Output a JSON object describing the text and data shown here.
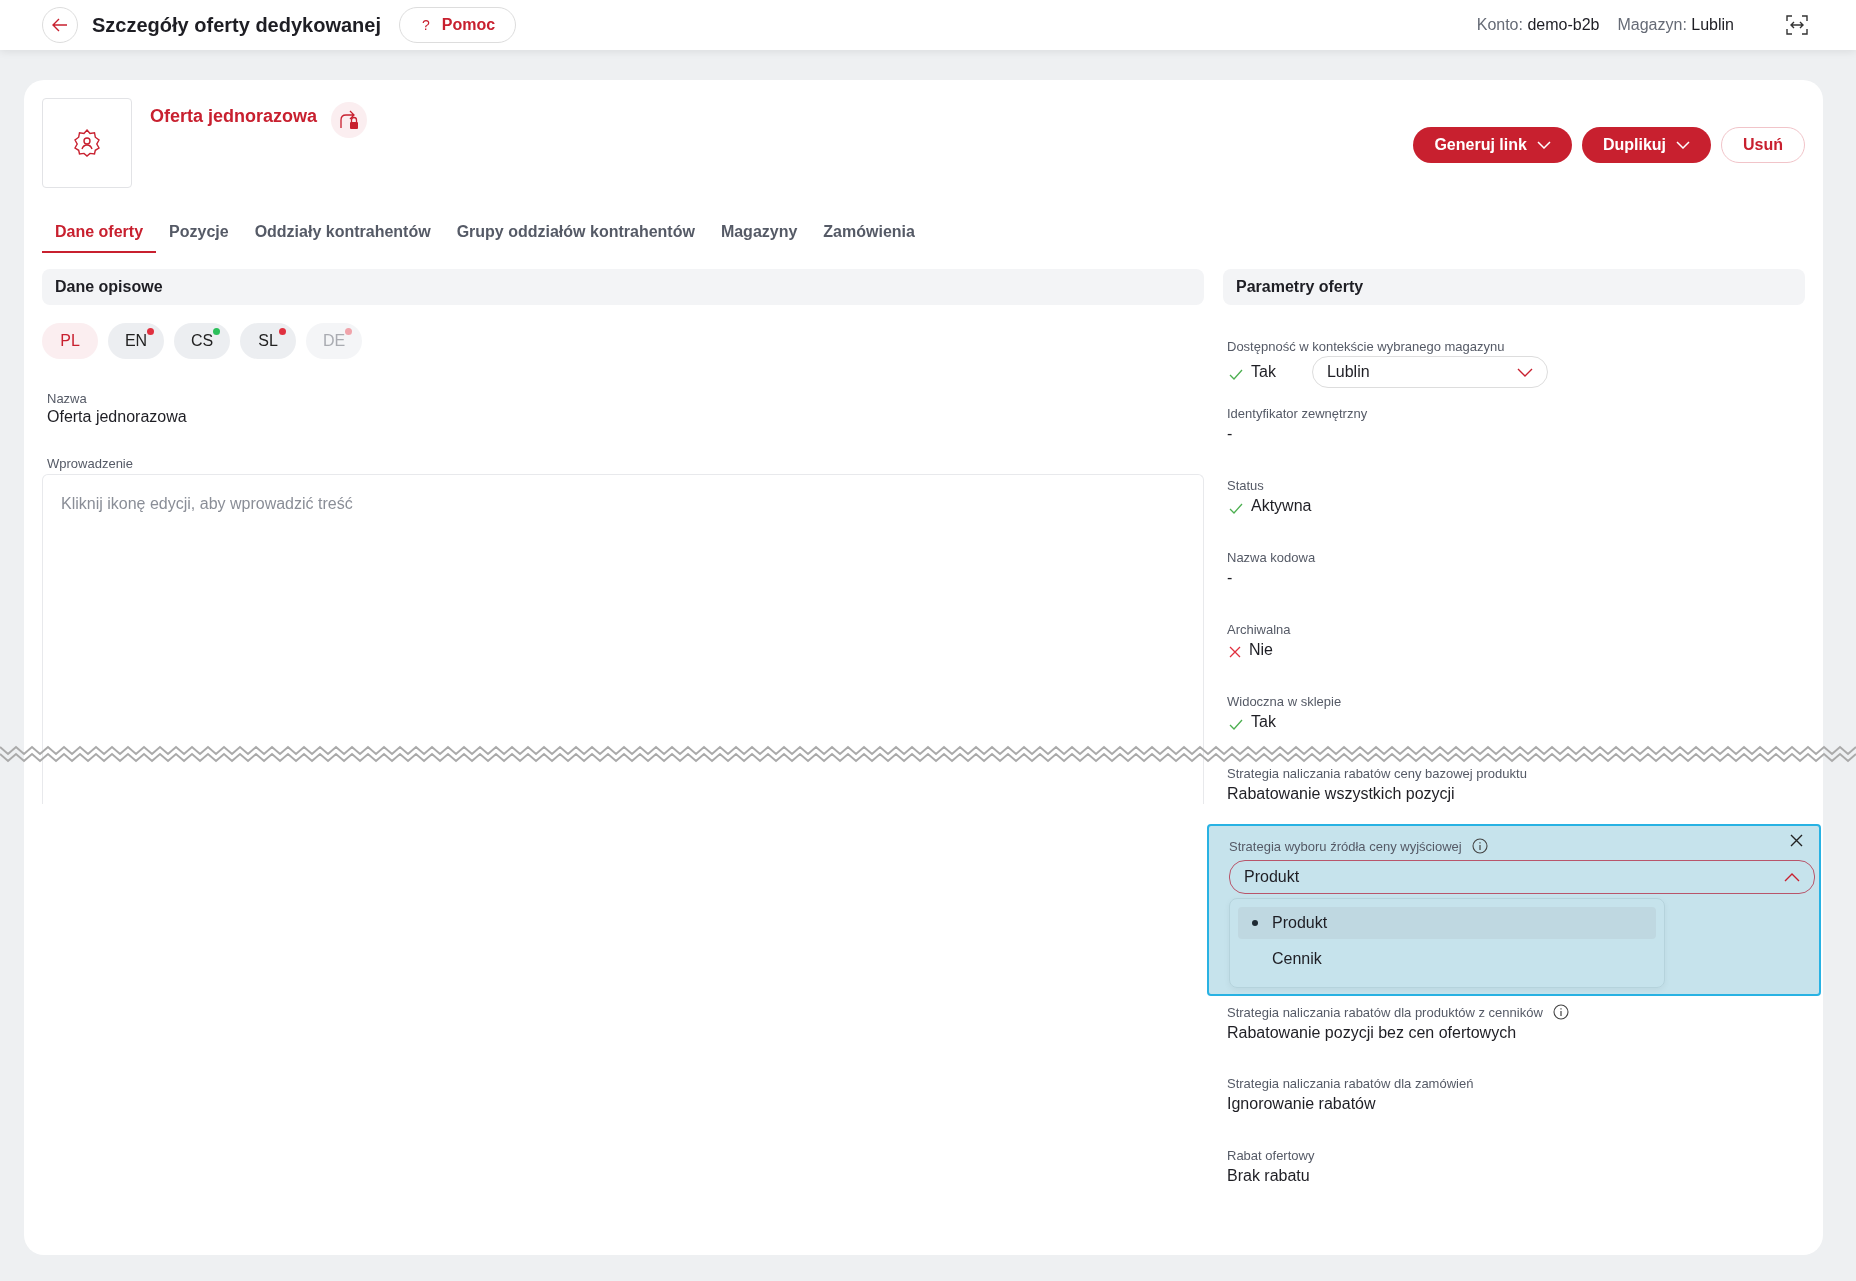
{
  "header": {
    "title": "Szczegóły oferty dedykowanej",
    "help_button": {
      "icon": "?",
      "label": "Pomoc"
    },
    "account": {
      "label": "Konto:",
      "value": "demo-b2b"
    },
    "warehouse": {
      "label": "Magazyn:",
      "value": "Lublin"
    }
  },
  "offer": {
    "name": "Oferta jednorazowa",
    "actions": [
      {
        "label": "Generuj link",
        "kind": "dropdown"
      },
      {
        "label": "Duplikuj",
        "kind": "dropdown"
      },
      {
        "label": "Usuń",
        "kind": "outline"
      }
    ]
  },
  "tabs": [
    {
      "label": "Dane oferty",
      "selected": true
    },
    {
      "label": "Pozycje",
      "selected": false
    },
    {
      "label": "Oddziały kontrahentów",
      "selected": false
    },
    {
      "label": "Grupy oddziałów kontrahentów",
      "selected": false
    },
    {
      "label": "Magazyny",
      "selected": false
    },
    {
      "label": "Zamówienia",
      "selected": false
    }
  ],
  "descriptive": {
    "title": "Dane opisowe",
    "languages": [
      {
        "code": "PL",
        "selected": true,
        "disabled": false
      },
      {
        "code": "EN",
        "selected": false,
        "disabled": false,
        "color": "#e0303f"
      },
      {
        "code": "CS",
        "selected": false,
        "disabled": false,
        "color": "#2bbf5a"
      },
      {
        "code": "SL",
        "selected": false,
        "disabled": false,
        "color": "#e0303f"
      },
      {
        "code": "DE",
        "selected": false,
        "disabled": true,
        "color": "#f0a3aa"
      }
    ],
    "name": {
      "label": "Nazwa",
      "value": "Oferta jednorazowa"
    },
    "intro": {
      "label": "Wprowadzenie",
      "placeholder": "Kliknij ikonę edycji, aby wprowadzić treść"
    }
  },
  "parameters": {
    "title": "Parametry oferty",
    "items": [
      {
        "kind": "availability",
        "label": "Dostępność w kontekście wybranego magazynu",
        "ok": true,
        "value": "Tak",
        "select": "Lublin"
      },
      {
        "kind": "text",
        "label": "Identyfikator zewnętrzny",
        "value": "-"
      },
      {
        "kind": "flag",
        "label": "Status",
        "ok": true,
        "value": "Aktywna"
      },
      {
        "kind": "text",
        "label": "Nazwa kodowa",
        "value": "-"
      },
      {
        "kind": "flag",
        "label": "Archiwalna",
        "ok": false,
        "value": "Nie"
      },
      {
        "kind": "flag",
        "label": "Widoczna w sklepie",
        "ok": true,
        "value": "Tak"
      },
      {
        "kind": "text",
        "label": "Strategia naliczania rabatów ceny bazowej produktu",
        "value": "Rabatowanie wszystkich pozycji"
      },
      {
        "kind": "open_select",
        "label": "Strategia wyboru źródła ceny wyjściowej",
        "info": true,
        "highlighted": true,
        "value": "Produkt",
        "options": [
          {
            "label": "Produkt",
            "selected": true
          },
          {
            "label": "Cennik",
            "selected": false
          }
        ]
      },
      {
        "kind": "text",
        "label": "Strategia naliczania rabatów dla produktów z cenników",
        "info": true,
        "value": "Rabatowanie pozycji bez cen ofertowych"
      },
      {
        "kind": "text",
        "label": "Strategia naliczania rabatów dla zamówień",
        "value": "Ignorowanie rabatów"
      },
      {
        "kind": "text",
        "label": "Rabat ofertowy",
        "value": "Brak rabatu"
      }
    ]
  }
}
